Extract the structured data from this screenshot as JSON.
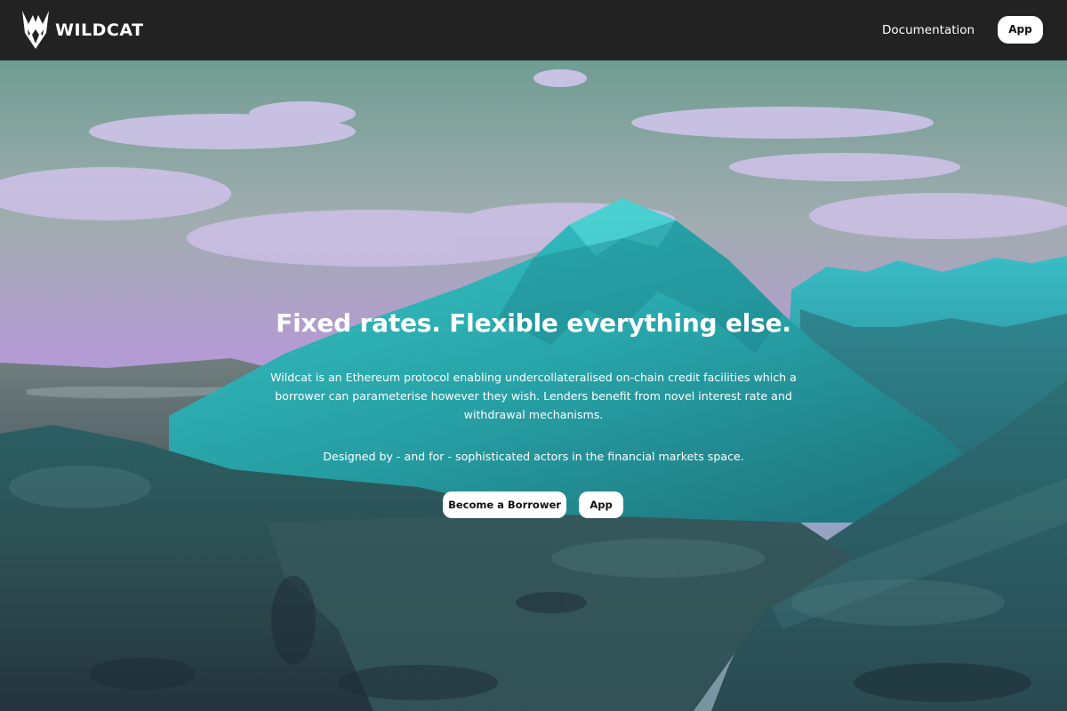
{
  "navbar": {
    "brand_name": "WILDCAT",
    "logo_icon": "wildcat-logo-icon",
    "documentation_label": "Documentation",
    "app_label": "App"
  },
  "hero": {
    "background": "mountain-landscape-image",
    "headline": "Fixed rates. Flexible everything else.",
    "description": "Wildcat is an Ethereum protocol enabling undercollateralised on-chain credit facilities which a borrower can parameterise however they wish. Lenders benefit from novel interest rate and withdrawal mechanisms.",
    "tagline": "Designed by - and for - sophisticated actors in the financial markets space.",
    "borrower_button_label": "Become a Borrower",
    "app_button_label": "App"
  },
  "colors": {
    "navbar_background": "#222222",
    "button_background": "#ffffff",
    "button_text": "#111111",
    "text": "#ffffff"
  }
}
